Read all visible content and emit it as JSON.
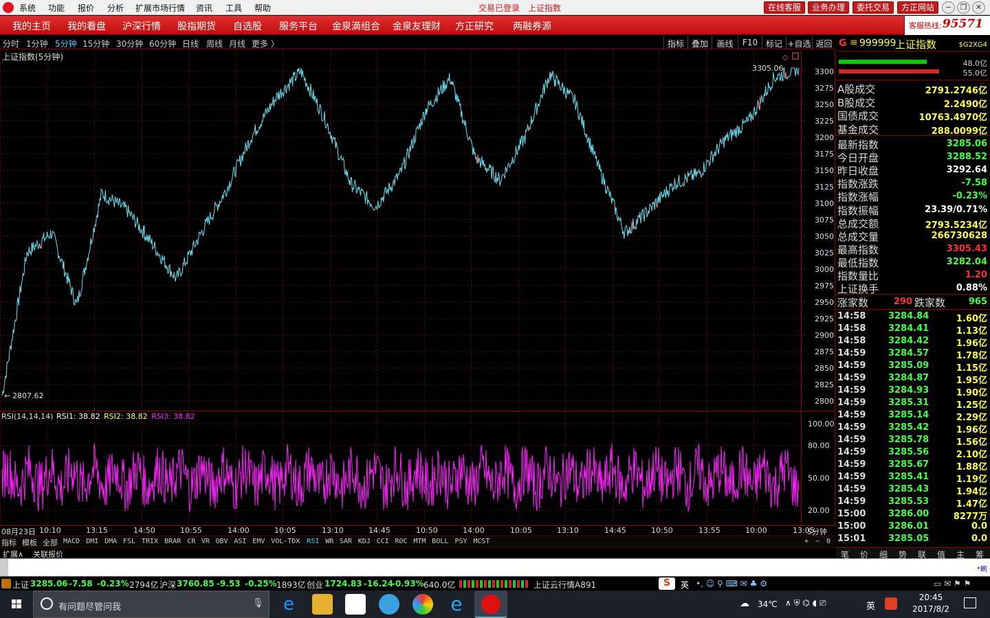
{
  "menubar": {
    "items": [
      "系统",
      "功能",
      "报价",
      "分析",
      "扩展市场行情",
      "资讯",
      "工具",
      "帮助"
    ],
    "center": [
      "交易已登录",
      "上证指数"
    ],
    "buttons": [
      "在线客服",
      "业务办理",
      "委托交易",
      "方正网站"
    ]
  },
  "navbar": {
    "items": [
      "我的主页",
      "我的看盘",
      "沪深行情",
      "股指期货",
      "自选股",
      "服务平台",
      "金泉滴组合",
      "金泉友理财",
      "方正研究",
      "两融券源"
    ],
    "hotline_label": "客服热线:",
    "hotline_number": "95571"
  },
  "periodbar": {
    "periods": [
      "分时",
      "1分钟",
      "5分钟",
      "15分钟",
      "30分钟",
      "60分钟",
      "日线",
      "周线",
      "月线",
      "更多 〉"
    ],
    "selected_index": 2,
    "tools": [
      "指标",
      "叠加",
      "画线",
      "F10",
      "标记",
      "+自选",
      "返回"
    ]
  },
  "main_chart": {
    "title": "上证指数(5分钟)",
    "high_label": "3305.06",
    "low_label": "2807.62",
    "y_ticks": [
      "3300",
      "3275",
      "3250",
      "3225",
      "3200",
      "3175",
      "3150",
      "3125",
      "3100",
      "3075",
      "3050",
      "3025",
      "3000",
      "2975",
      "2950",
      "2925",
      "2900",
      "2875",
      "2850",
      "2825",
      "2800"
    ]
  },
  "chart_data": [
    {
      "type": "line",
      "title": "上证指数(5分钟)",
      "ylim": [
        2800,
        3305
      ],
      "x": [
        "08月23日",
        "10:10",
        "13:15",
        "14:50",
        "10:55",
        "14:00",
        "10:05",
        "13:10",
        "14:45",
        "10:50",
        "14:00",
        "10:05",
        "13:10",
        "14:45",
        "10:50",
        "13:55",
        "10:00",
        "13:05"
      ],
      "series": [
        {
          "values": [
            2808,
            3025,
            3055,
            2945,
            3115,
            3090,
            3040,
            2985,
            3055,
            3120,
            3200,
            3260,
            3300,
            3225,
            3130,
            3095,
            3145,
            3240,
            3290,
            3170,
            3135,
            3200,
            3295,
            3255,
            3150,
            3055,
            3090,
            3130,
            3145,
            3195,
            3225,
            3290,
            3305
          ]
        }
      ]
    },
    {
      "type": "line",
      "title": "RSI(14,14,14)",
      "ylim": [
        10,
        100
      ],
      "series": [
        {
          "name": "RSI1",
          "values": [
            38.82
          ]
        },
        {
          "name": "RSI2",
          "values": [
            38.82
          ]
        },
        {
          "name": "RSI3",
          "values": [
            38.82
          ]
        }
      ]
    }
  ],
  "rsi": {
    "label": "RSI(14,14,14)",
    "rsi1_label": "RSI1: 38.82",
    "rsi2_label": "RSI2: 38.82",
    "rsi3_label": "RSI3: 38.82",
    "y_ticks": [
      "100.00",
      "80.00",
      "50.00",
      "20.00"
    ]
  },
  "time_axis": [
    "08月23日",
    "10:10",
    "13:15",
    "14:50",
    "10:55",
    "14:00",
    "10:05",
    "13:10",
    "14:45",
    "10:50",
    "14:00",
    "10:05",
    "13:10",
    "14:45",
    "10:50",
    "13:55",
    "10:00",
    "13:05"
  ],
  "time_axis_right": "5分钟",
  "indicator_tabs": [
    "指标",
    "模板",
    "全部",
    "MACD",
    "DMI",
    "DMA",
    "FSL",
    "TRIX",
    "BRAR",
    "CR",
    "VR",
    "OBV",
    "ASI",
    "EMV",
    "VOL-TDX",
    "RSI",
    "WR",
    "SAR",
    "KDJ",
    "CCI",
    "ROC",
    "MTM",
    "BOLL",
    "PSY",
    "MCST"
  ],
  "indicator_active": "RSI",
  "tab_controls": [
    "+",
    "−",
    "0"
  ],
  "tabs2": [
    "扩展∧",
    "关联报价"
  ],
  "right_panel": {
    "code": "999999",
    "name": "上证指数",
    "tag": "$G2XG4",
    "bar_green": "48.0亿",
    "bar_red": "55.0亿",
    "volumes": [
      {
        "k": "A股成交",
        "v": "2791.2746亿"
      },
      {
        "k": "B股成交",
        "v": "2.2490亿"
      },
      {
        "k": "国债成交",
        "v": "10763.4970亿"
      },
      {
        "k": "基金成交",
        "v": "288.0099亿"
      }
    ],
    "stats": [
      {
        "k": "最新指数",
        "v": "3285.06",
        "c": "#40ff40"
      },
      {
        "k": "今日开盘",
        "v": "3288.52",
        "c": "#40ff40"
      },
      {
        "k": "昨日收盘",
        "v": "3292.64",
        "c": "#ffffff"
      },
      {
        "k": "指数涨跌",
        "v": "-7.58",
        "c": "#40ff40"
      },
      {
        "k": "指数涨幅",
        "v": "-0.23%",
        "c": "#40ff40"
      },
      {
        "k": "指数振幅",
        "v": "23.39/0.71%",
        "c": "#ffffff"
      },
      {
        "k": "总成交额",
        "v": "2793.5234亿",
        "c": "#ffff40"
      },
      {
        "k": "总成交量",
        "v": "266730628",
        "c": "#ffff40"
      },
      {
        "k": "最高指数",
        "v": "3305.43",
        "c": "#ff3030"
      },
      {
        "k": "最低指数",
        "v": "3282.04",
        "c": "#40ff40"
      },
      {
        "k": "指数量比",
        "v": "1.20",
        "c": "#ff3030"
      },
      {
        "k": "上证换手",
        "v": "0.88%",
        "c": "#ffffff"
      }
    ],
    "up_label": "涨家数",
    "up_count": "290",
    "down_label": "跌家数",
    "down_count": "965",
    "ticks": [
      [
        "14:58",
        "3284.84",
        "1.60亿"
      ],
      [
        "14:58",
        "3284.41",
        "1.13亿"
      ],
      [
        "14:58",
        "3284.42",
        "1.96亿"
      ],
      [
        "14:59",
        "3284.57",
        "1.78亿"
      ],
      [
        "14:59",
        "3285.09",
        "1.15亿"
      ],
      [
        "14:59",
        "3284.87",
        "1.95亿"
      ],
      [
        "14:59",
        "3284.93",
        "1.90亿"
      ],
      [
        "14:59",
        "3285.31",
        "1.25亿"
      ],
      [
        "14:59",
        "3285.14",
        "2.29亿"
      ],
      [
        "14:59",
        "3285.42",
        "1.96亿"
      ],
      [
        "14:59",
        "3285.78",
        "1.56亿"
      ],
      [
        "14:59",
        "3285.56",
        "2.10亿"
      ],
      [
        "14:59",
        "3285.67",
        "1.88亿"
      ],
      [
        "14:59",
        "3285.41",
        "1.19亿"
      ],
      [
        "14:59",
        "3285.43",
        "1.94亿"
      ],
      [
        "14:59",
        "3285.53",
        "1.47亿"
      ],
      [
        "15:00",
        "3286.00",
        "8277万"
      ],
      [
        "15:00",
        "3286.01",
        "0.0"
      ],
      [
        "15:01",
        "3285.05",
        "0.0"
      ]
    ],
    "tabs": [
      "笔",
      "价",
      "细",
      "势",
      "联",
      "值",
      "主",
      "筹"
    ]
  },
  "blank_right": "*刷",
  "statusbar": {
    "sh_name": "上证",
    "sh_val": "3285.06",
    "sh_chg": "-7.58",
    "sh_pct": "-0.23%",
    "sh_amt": "2794亿",
    "hs_name": "沪深",
    "hs_val": "3760.85",
    "hs_chg": "-9.53",
    "hs_pct": "-0.25%",
    "hs_amt": "1893亿",
    "cy_name": "创业",
    "cy_val": "1724.83",
    "cy_chg": "-16.24",
    "cy_pct": "-0.93%",
    "cy_amt": "640.0亿",
    "cloud": "上证云行情A891",
    "ime": "英"
  },
  "taskbar": {
    "search": "有问题尽管问我",
    "weather": "34℃",
    "ime": "英",
    "time": "20:45",
    "date": "2017/8/2"
  },
  "colors": {
    "up": "#ff3030",
    "down": "#40ff40",
    "line": "#66e0f0",
    "rsi": "#ff20ff",
    "grid": "#5a0a0a",
    "accent_red": "#c00c0c"
  }
}
